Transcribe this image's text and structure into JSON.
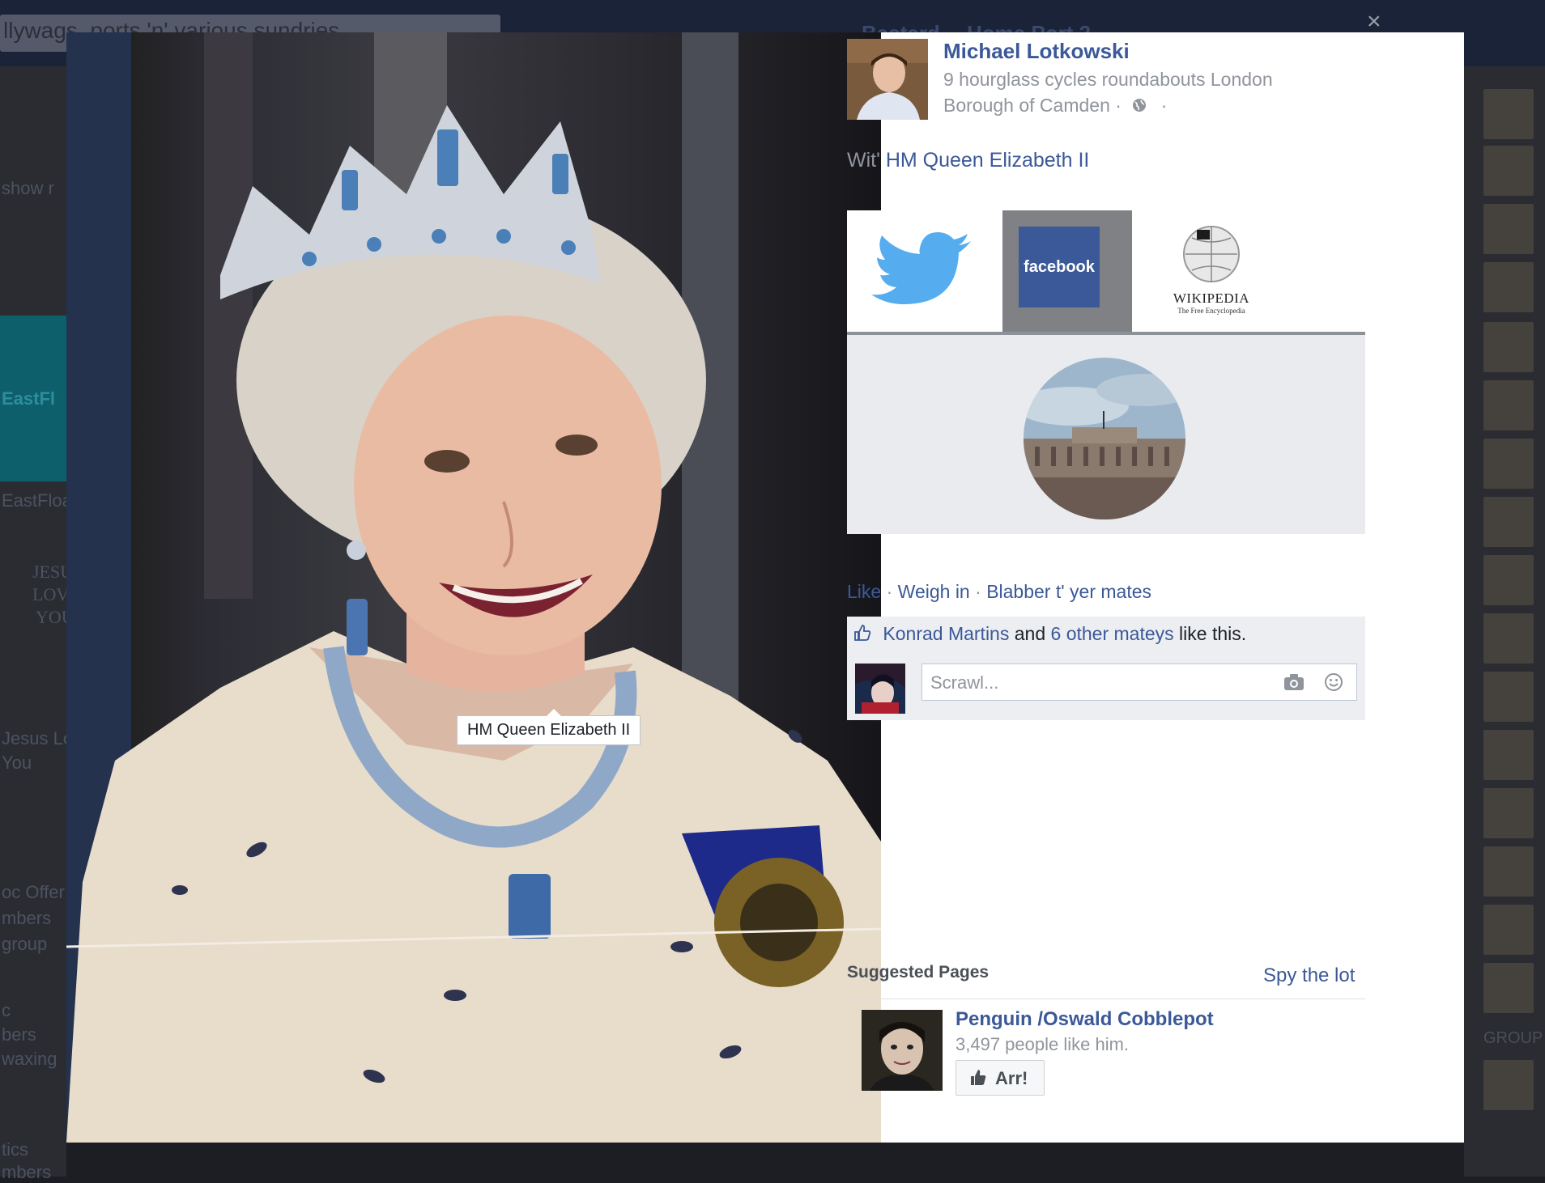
{
  "background": {
    "search_text": "llywags, ports 'n' various sundries",
    "topnav": [
      "Bastard",
      "Home Port 2"
    ],
    "left_fragments": [
      "show r",
      "EastFl",
      "EastFloa",
      "JESUS",
      "LOVES",
      "YOU",
      "Jesus Lo",
      "You",
      "oc Offer",
      "mbers",
      "group",
      "c",
      "bers",
      "waxing",
      "tics",
      "mbers"
    ],
    "right_group_label": "GROUP"
  },
  "photo": {
    "tag_label": "HM Queen Elizabeth II"
  },
  "panel": {
    "close_symbol": "×",
    "poster_name": "Michael Lotkowski",
    "poster_location": "9 hourglass cycles roundabouts London Borough of Camden ·",
    "poster_trailing_dot": "·",
    "with_prefix": "Wit'",
    "with_name": "HM Queen Elizabeth II",
    "embed": {
      "facebook_label": "facebook",
      "wikipedia_title": "WIKIPEDIA",
      "wikipedia_subtitle": "The Free Encyclopedia"
    },
    "actions": {
      "like": "Like",
      "sep": "·",
      "weigh_in": "Weigh in",
      "blabber": "Blabber t' yer mates"
    },
    "likes": {
      "name": "Konrad Martins",
      "and": "and",
      "others": "6 other mateys",
      "suffix": "like this."
    },
    "comment_placeholder": "Scrawl...",
    "suggested": {
      "title": "Suggested Pages",
      "spy_lot": "Spy the lot",
      "page_name": "Penguin /Oswald Cobblepot",
      "page_likes": "3,497 people like him.",
      "button_label": "Arr!"
    }
  },
  "colors": {
    "fb_blue": "#3b5998",
    "twitter_blue": "#55acee",
    "muted_text": "#90949c"
  }
}
